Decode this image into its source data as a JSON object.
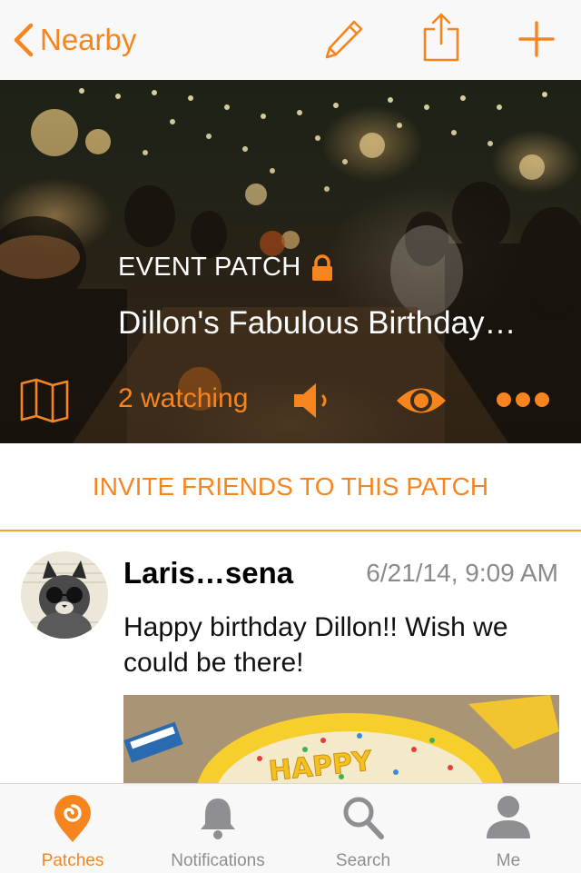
{
  "nav": {
    "back_label": "Nearby",
    "icons": [
      "chevron-left-icon",
      "pencil-icon",
      "share-icon",
      "plus-icon"
    ]
  },
  "hero": {
    "patch_type": "EVENT PATCH",
    "title": "Dillon's Fabulous Birthday…",
    "watching": "2 watching",
    "icons": [
      "lock-icon",
      "map-icon",
      "speaker-icon",
      "eye-icon",
      "more-icon"
    ]
  },
  "invite": {
    "label": "INVITE FRIENDS TO THIS PATCH"
  },
  "post": {
    "author": "Laris…sena",
    "timestamp": "6/21/14, 9:09 AM",
    "message": "Happy birthday Dillon!! Wish we could be there!",
    "photo_text": "HAPPY"
  },
  "tabbar": {
    "tabs": [
      {
        "label": "Patches",
        "icon": "patches-icon",
        "active": true
      },
      {
        "label": "Notifications",
        "icon": "bell-icon",
        "active": false
      },
      {
        "label": "Search",
        "icon": "search-icon",
        "active": false
      },
      {
        "label": "Me",
        "icon": "person-icon",
        "active": false
      }
    ]
  },
  "colors": {
    "accent": "#f7851f",
    "inactive": "#8e8e93",
    "divider": "#f0a030"
  }
}
